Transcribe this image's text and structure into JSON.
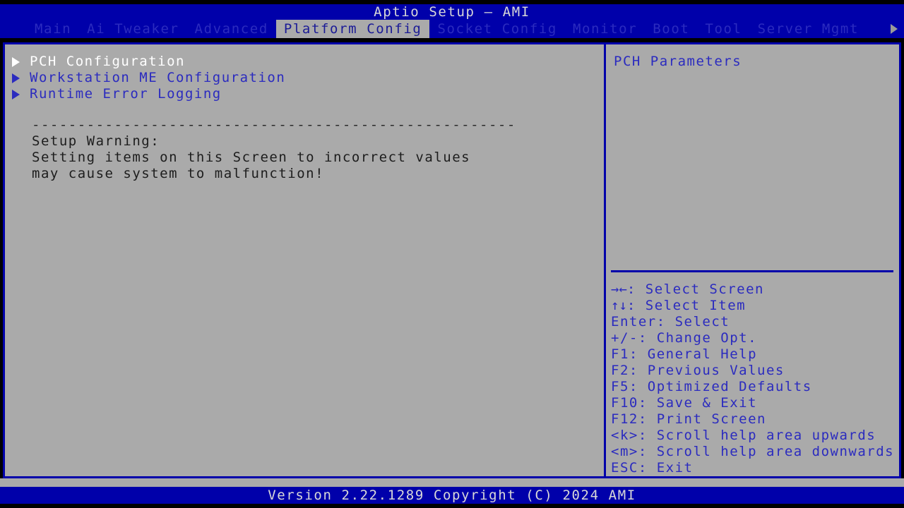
{
  "window": {
    "title": "Aptio Setup – AMI"
  },
  "menubar": {
    "items": [
      {
        "label": "Main",
        "active": false
      },
      {
        "label": "Ai Tweaker",
        "active": false
      },
      {
        "label": "Advanced",
        "active": false
      },
      {
        "label": "Platform Config",
        "active": true
      },
      {
        "label": "Socket Config",
        "active": false
      },
      {
        "label": "Monitor",
        "active": false
      },
      {
        "label": "Boot",
        "active": false
      },
      {
        "label": "Tool",
        "active": false
      },
      {
        "label": "Server Mgmt",
        "active": false
      }
    ],
    "more_icon": "chevron-right-icon"
  },
  "main": {
    "nav_items": [
      {
        "label": "PCH Configuration",
        "selected": true
      },
      {
        "label": "Workstation ME Configuration",
        "selected": false
      },
      {
        "label": "Runtime Error Logging",
        "selected": false
      }
    ],
    "separator": "-----------------------------------------------------",
    "warning_lines": [
      "Setup Warning:",
      "Setting items on this Screen to incorrect values",
      "may cause system to malfunction!"
    ]
  },
  "help": {
    "description": "PCH Parameters",
    "keys": [
      {
        "glyph": "→←",
        "text": ": Select Screen"
      },
      {
        "glyph": "↑↓",
        "text": ": Select Item"
      },
      {
        "glyph": "",
        "text": "Enter: Select"
      },
      {
        "glyph": "",
        "text": "+/-: Change Opt."
      },
      {
        "glyph": "",
        "text": "F1: General Help"
      },
      {
        "glyph": "",
        "text": "F2: Previous Values"
      },
      {
        "glyph": "",
        "text": "F5: Optimized Defaults"
      },
      {
        "glyph": "",
        "text": "F10: Save & Exit"
      },
      {
        "glyph": "",
        "text": "F12: Print Screen"
      },
      {
        "glyph": "",
        "text": "<k>: Scroll help area upwards"
      },
      {
        "glyph": "",
        "text": "<m>: Scroll help area downwards"
      },
      {
        "glyph": "",
        "text": "ESC: Exit"
      }
    ]
  },
  "footer": {
    "version": "Version 2.22.1289 Copyright (C) 2024 AMI"
  },
  "colors": {
    "bios_blue": "#0000aa",
    "panel_gray": "#aaaaaa",
    "text_blue": "#2b2bbf",
    "selected_white": "#ffffff",
    "title_text": "#d8d8d8"
  }
}
